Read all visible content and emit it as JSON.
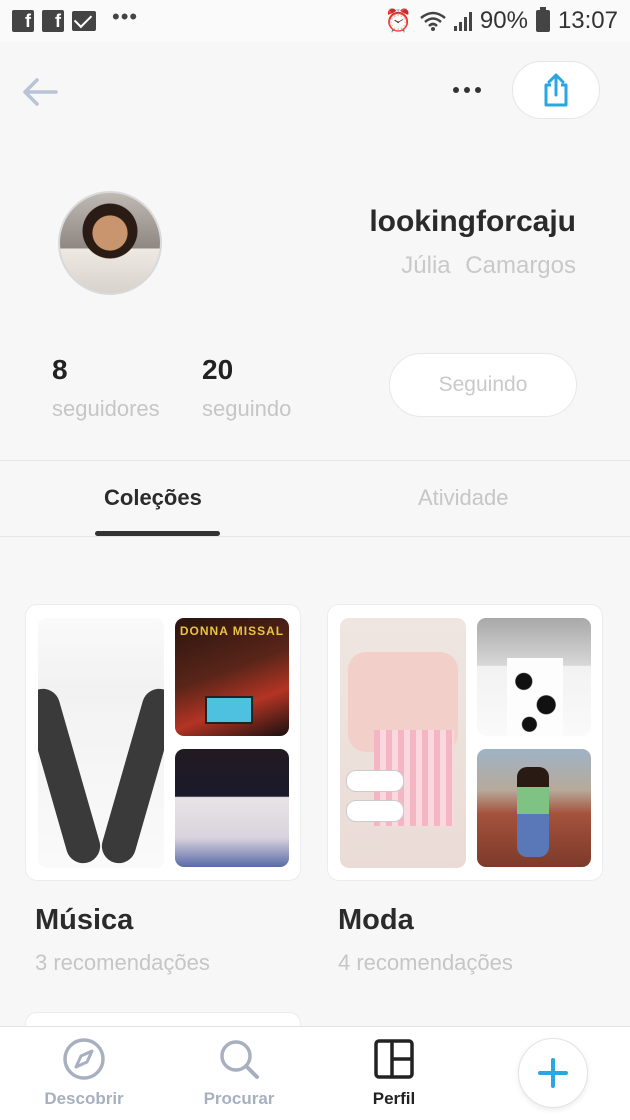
{
  "status_bar": {
    "left_icons": [
      "facebook-icon",
      "facebook-icon",
      "mail-icon",
      "more-dots-icon"
    ],
    "battery": "90%",
    "time": "13:07"
  },
  "top_bar": {
    "icons": {
      "back": "arrow-left-icon",
      "more": "more-dots-icon",
      "share": "share-icon"
    },
    "accent": "#2aa7e1"
  },
  "profile": {
    "username": "lookingforcaju",
    "full_name": "Júlia  Camargos",
    "followers_count": "8",
    "followers_label": "seguidores",
    "following_count": "20",
    "following_label": "seguindo",
    "follow_button": "Seguindo"
  },
  "tabs": [
    {
      "label": "Coleções",
      "active": true
    },
    {
      "label": "Atividade",
      "active": false
    }
  ],
  "collections": [
    {
      "title": "Música",
      "subtitle": "3 recomendações",
      "thumb_text": {
        "band": "DONNA MISSAL"
      }
    },
    {
      "title": "Moda",
      "subtitle": "4 recomendações"
    }
  ],
  "bottom_nav": [
    {
      "label": "Descobrir",
      "icon": "compass-icon",
      "active": false
    },
    {
      "label": "Procurar",
      "icon": "search-icon",
      "active": false
    },
    {
      "label": "Perfil",
      "icon": "layout-grid-icon",
      "active": true
    }
  ],
  "fab_icon": "plus-icon"
}
